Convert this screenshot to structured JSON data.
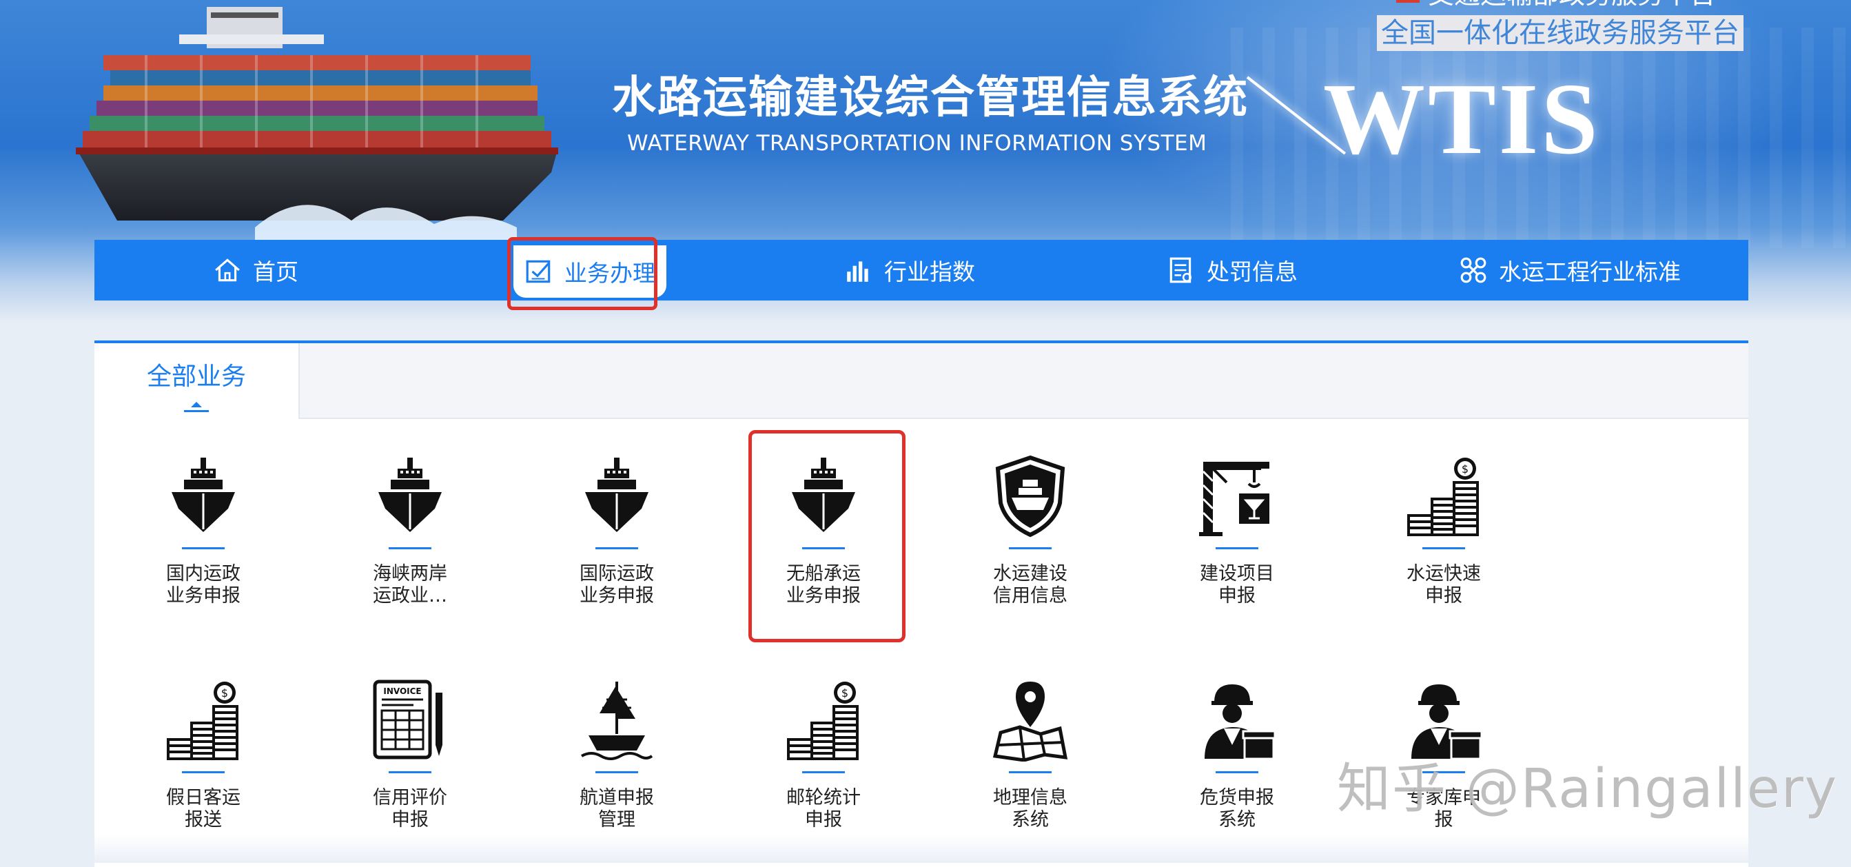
{
  "header": {
    "top_partial_text": "交通运输部政务服务平台",
    "gov_platform_link": "全国一体化在线政务服务平台",
    "system_title": "水路运输建设综合管理信息系统",
    "system_subtitle": "WATERWAY TRANSPORTATION INFORMATION SYSTEM",
    "logo_text": "WTIS"
  },
  "nav": {
    "items": [
      {
        "label": "首页",
        "icon": "home-icon"
      },
      {
        "label": "业务办理",
        "icon": "check-document-icon",
        "active": true
      },
      {
        "label": "行业指数",
        "icon": "bar-chart-icon"
      },
      {
        "label": "处罚信息",
        "icon": "list-document-icon"
      },
      {
        "label": "水运工程行业标准",
        "icon": "tools-icon"
      }
    ]
  },
  "tabs": [
    {
      "label": "全部业务",
      "active": true
    }
  ],
  "services": [
    {
      "line1": "国内运政",
      "line2": "业务申报",
      "icon": "ship-icon"
    },
    {
      "line1": "海峡两岸",
      "line2": "运政业…",
      "icon": "ship-icon"
    },
    {
      "line1": "国际运政",
      "line2": "业务申报",
      "icon": "ship-icon"
    },
    {
      "line1": "无船承运",
      "line2": "业务申报",
      "icon": "ship-icon"
    },
    {
      "line1": "水运建设",
      "line2": "信用信息",
      "icon": "shield-ship-icon"
    },
    {
      "line1": "建设项目",
      "line2": "申报",
      "icon": "crane-icon"
    },
    {
      "line1": "水运快速",
      "line2": "申报",
      "icon": "coin-stack-icon"
    },
    {
      "line1": "假日客运",
      "line2": "报送",
      "icon": "coin-stack-icon"
    },
    {
      "line1": "信用评价",
      "line2": "申报",
      "icon": "invoice-icon"
    },
    {
      "line1": "航道申报",
      "line2": "管理",
      "icon": "sailboat-icon"
    },
    {
      "line1": "邮轮统计",
      "line2": "申报",
      "icon": "coin-stack-icon"
    },
    {
      "line1": "地理信息",
      "line2": "系统",
      "icon": "map-pin-icon"
    },
    {
      "line1": "危货申报",
      "line2": "系统",
      "icon": "worker-box-icon"
    },
    {
      "line1": "专家库申",
      "line2": "报",
      "icon": "worker-box-icon"
    }
  ],
  "watermark": "知乎 @Raingallery",
  "colors": {
    "nav_blue": "#1a7ef0",
    "highlight_red": "#e0302a",
    "banner_blue": "#2b74cf"
  }
}
